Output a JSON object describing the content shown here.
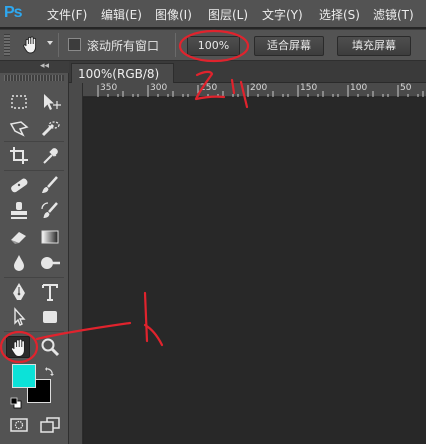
{
  "app": {
    "logo": "Ps"
  },
  "menu": [
    "文件(F)",
    "编辑(E)",
    "图像(I)",
    "图层(L)",
    "文字(Y)",
    "选择(S)",
    "滤镜(T)"
  ],
  "options": {
    "tool_icon": "hand-icon",
    "scroll_all_windows": {
      "label": "滚动所有窗口",
      "checked": false
    },
    "zoom_button": "100%",
    "fit_screen_button": "适合屏幕",
    "fill_screen_button": "填充屏幕"
  },
  "toolbox": {
    "collapse": "◂◂",
    "tools": [
      "marquee-icon",
      "move-icon",
      "polygonal-lasso-icon",
      "quick-selection-icon",
      "crop-icon",
      "eyedropper-icon",
      "healing-brush-icon",
      "brush-icon",
      "clone-stamp-icon",
      "history-brush-icon",
      "eraser-icon",
      "gradient-icon",
      "blur-icon",
      "dodge-icon",
      "pen-icon",
      "type-icon",
      "path-selection-icon",
      "rectangle-shape-icon",
      "hand-icon",
      "zoom-icon"
    ],
    "foreground_color": "#0ce2d8",
    "background_color": "#000000"
  },
  "document": {
    "tab_close": "×",
    "tab_title": "100%(RGB/8)",
    "ruler_labels": [
      "350",
      "300",
      "250",
      "200",
      "150",
      "100",
      "50"
    ]
  },
  "annotations": {
    "arrow_number": "1",
    "zoom_number": "2"
  }
}
